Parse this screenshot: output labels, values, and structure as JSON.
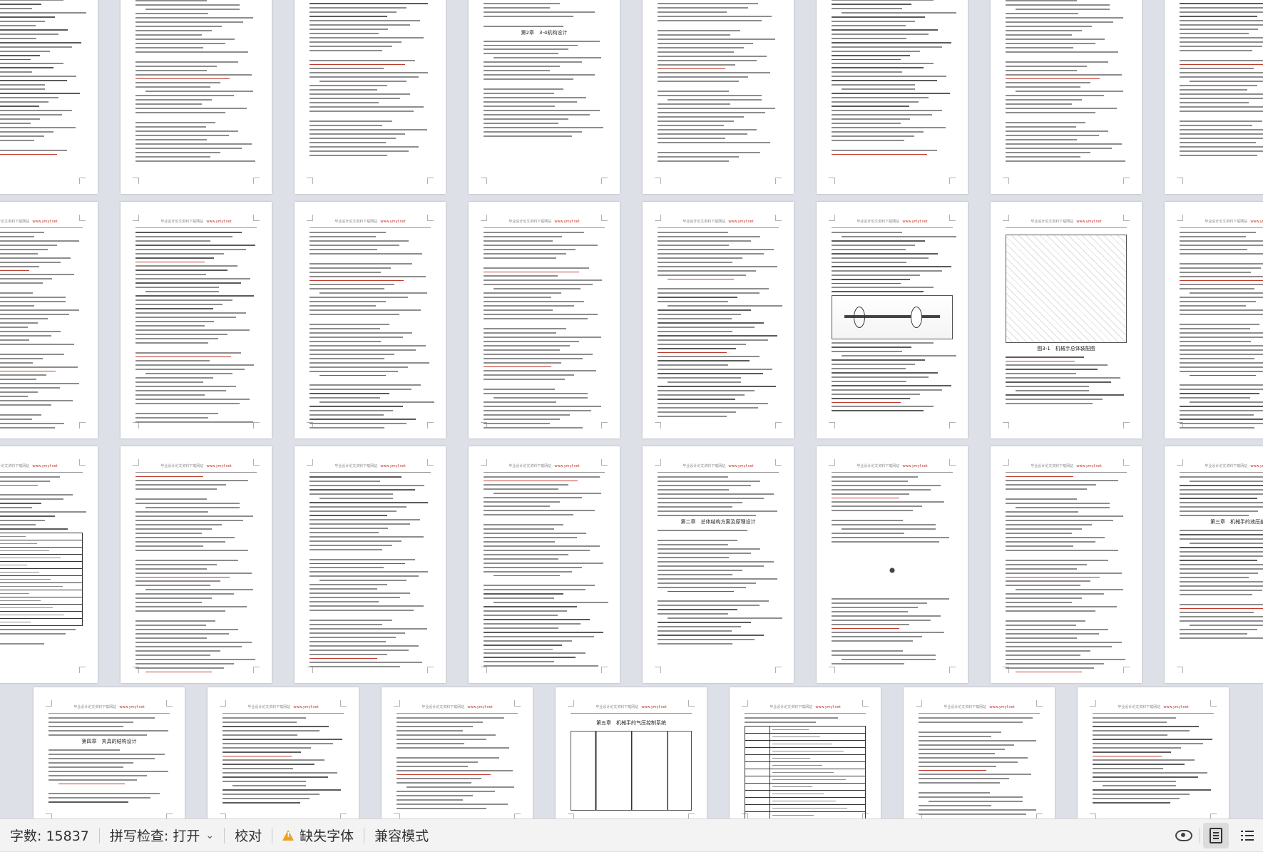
{
  "document": {
    "header_text": "毕业设计论文资料下载网站",
    "header_watermark": "www.ymyf.net",
    "page_titles": {
      "chapter2": "第二章　总体结构方案及原理设计",
      "chapter2_sub": "第2章　3-4机构设计",
      "chapter3": "第三章　机械手的液压部分",
      "chapter4": "第四章　夹具的结构设计",
      "pneumatic": "第五章　机械手的气压控制系统",
      "figure_caption": "图3-1　机械手总体装配图"
    }
  },
  "statusbar": {
    "word_count": "字数: 15837",
    "spell_check": "拼写检查: 打开",
    "proofread": "校对",
    "missing_font": "缺失字体",
    "compat_mode": "兼容模式"
  }
}
